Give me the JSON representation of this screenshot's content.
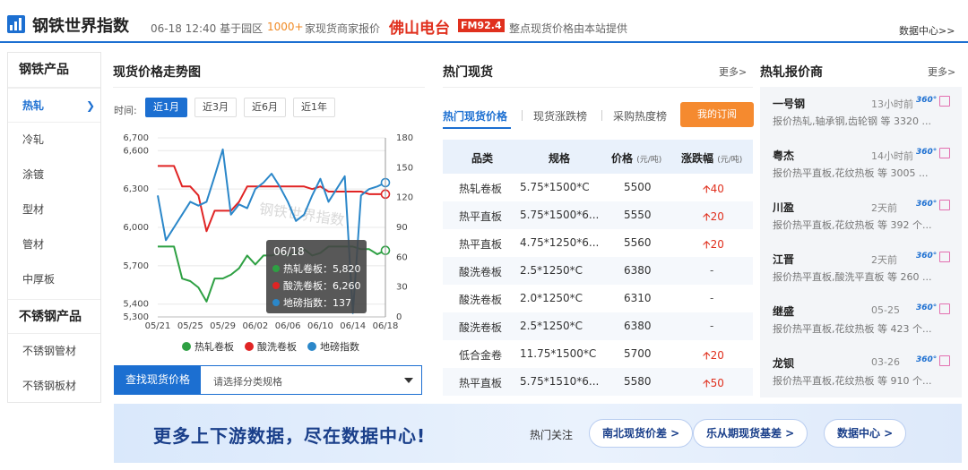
{
  "header": {
    "site_title": "钢铁世界指数",
    "datetime": "06-18 12:40 基于园区",
    "count": "1000+",
    "desc": "家现货商家报价",
    "radio_name": "佛山电台",
    "radio_freq": "FM92.4",
    "provided": "整点现货价格由本站提供",
    "data_center": "数据中心>>"
  },
  "nav": {
    "group1_title": "钢铁产品",
    "group1": [
      "热轧",
      "冷轧",
      "涂镀",
      "型材",
      "管材",
      "中厚板"
    ],
    "group2_title": "不锈钢产品",
    "group2": [
      "不锈钢管材",
      "不锈钢板材"
    ]
  },
  "chart_panel": {
    "title": "现货价格走势图",
    "time_label": "时间:",
    "ranges": [
      "近1月",
      "近3月",
      "近6月",
      "近1年"
    ],
    "search_button": "查找现货价格",
    "search_placeholder": "请选择分类规格",
    "tooltip_date": "06/18",
    "tooltip_lines": [
      "热轧卷板：5,820",
      "酸洗卷板：6,260",
      "地磅指数：137"
    ]
  },
  "chart_data": {
    "type": "line",
    "x": [
      "05/21",
      "05/22",
      "05/23",
      "05/24",
      "05/25",
      "05/26",
      "05/27",
      "05/28",
      "05/29",
      "05/30",
      "05/31",
      "06/01",
      "06/02",
      "06/03",
      "06/04",
      "06/05",
      "06/06",
      "06/07",
      "06/08",
      "06/09",
      "06/10",
      "06/11",
      "06/12",
      "06/13",
      "06/14",
      "06/15",
      "06/16",
      "06/17",
      "06/18"
    ],
    "x_ticks": [
      "05/21",
      "05/25",
      "05/29",
      "06/02",
      "06/06",
      "06/10",
      "06/14",
      "06/18"
    ],
    "left_axis": {
      "ticks": [
        "5,300",
        "5,400",
        "5,700",
        "6,000",
        "6,300",
        "6,600",
        "6,700"
      ],
      "ylim": [
        5300,
        6700
      ]
    },
    "right_axis": {
      "ticks": [
        "0",
        "30",
        "60",
        "90",
        "120",
        "150",
        "180"
      ],
      "ylim": [
        0,
        180
      ]
    },
    "series": [
      {
        "name": "热轧卷板",
        "axis": "left",
        "color": "#2ea043",
        "values": [
          5850,
          5850,
          5850,
          5600,
          5580,
          5530,
          5420,
          5600,
          5600,
          5630,
          5680,
          5780,
          5710,
          5780,
          5780,
          5800,
          5780,
          5800,
          5830,
          5780,
          5800,
          5850,
          5850,
          5850,
          5850,
          5830,
          5830,
          5790,
          5820
        ]
      },
      {
        "name": "酸洗卷板",
        "axis": "left",
        "color": "#e02424",
        "values": [
          6480,
          6480,
          6480,
          6320,
          6320,
          6250,
          5970,
          6130,
          6130,
          6130,
          6200,
          6320,
          6320,
          6320,
          6320,
          6320,
          6320,
          6320,
          6320,
          6300,
          6320,
          6280,
          6280,
          6280,
          6280,
          6280,
          6260,
          6260,
          6260
        ]
      },
      {
        "name": "地磅指数",
        "axis": "left",
        "color": "#2b87c9",
        "values": [
          6250,
          5900,
          6000,
          6100,
          6200,
          6170,
          6200,
          6400,
          6610,
          6100,
          6180,
          6150,
          6300,
          6350,
          6420,
          6320,
          6200,
          6050,
          6100,
          6250,
          6380,
          6200,
          6300,
          6400,
          5330,
          6250,
          6300,
          6320,
          6350
        ]
      }
    ],
    "legend": [
      "热轧卷板",
      "酸洗卷板",
      "地磅指数"
    ],
    "legend_position": "bottom"
  },
  "hot": {
    "title": "热门现货",
    "more": "更多>",
    "tabs": [
      "热门现货价格",
      "现货涨跌榜",
      "采购热度榜"
    ],
    "subscribe": "我的订阅",
    "headers": {
      "c1": "品类",
      "c2": "规格",
      "c3": "价格",
      "c3u": "(元/吨)",
      "c4": "涨跌幅",
      "c4u": "(元/吨)"
    },
    "rows": [
      {
        "cat": "热轧卷板",
        "spec": "5.75*1500*C",
        "price": "5500",
        "chg": "40",
        "up": true
      },
      {
        "cat": "热平直板",
        "spec": "5.75*1500*6...",
        "price": "5550",
        "chg": "20",
        "up": true
      },
      {
        "cat": "热平直板",
        "spec": "4.75*1250*6...",
        "price": "5560",
        "chg": "20",
        "up": true
      },
      {
        "cat": "酸洗卷板",
        "spec": "2.5*1250*C",
        "price": "6380",
        "chg": "-",
        "up": false
      },
      {
        "cat": "酸洗卷板",
        "spec": "2.0*1250*C",
        "price": "6310",
        "chg": "-",
        "up": false
      },
      {
        "cat": "酸洗卷板",
        "spec": "2.5*1250*C",
        "price": "6380",
        "chg": "-",
        "up": false
      },
      {
        "cat": "低合金卷",
        "spec": "11.75*1500*C",
        "price": "5700",
        "chg": "20",
        "up": true
      },
      {
        "cat": "热平直板",
        "spec": "5.75*1510*6...",
        "price": "5580",
        "chg": "50",
        "up": true
      }
    ]
  },
  "quotes": {
    "title": "热轧报价商",
    "more": "更多>",
    "items": [
      {
        "name": "一号钢",
        "time": "13小时前",
        "desc": "报价热轧,轴承钢,齿轮钢 等 3320 ..."
      },
      {
        "name": "粤杰",
        "time": "14小时前",
        "desc": "报价热平直板,花纹热板 等 3005 ..."
      },
      {
        "name": "川盈",
        "time": "2天前",
        "desc": "报价热平直板,花纹热板 等 392 个..."
      },
      {
        "name": "江晋",
        "time": "2天前",
        "desc": "报价热平直板,酸洗平直板 等 260 ..."
      },
      {
        "name": "继盛",
        "time": "05-25",
        "desc": "报价热平直板,花纹热板 等 423 个..."
      },
      {
        "name": "龙钡",
        "time": "03-26",
        "desc": "报价热平直板,花纹热板 等 910 个..."
      }
    ]
  },
  "banner": {
    "text": "更多上下游数据，尽在数据中心!",
    "focus": "热门关注",
    "pills": [
      "南北现货价差 >",
      "乐从期现货基差 >",
      "数据中心 >"
    ]
  }
}
